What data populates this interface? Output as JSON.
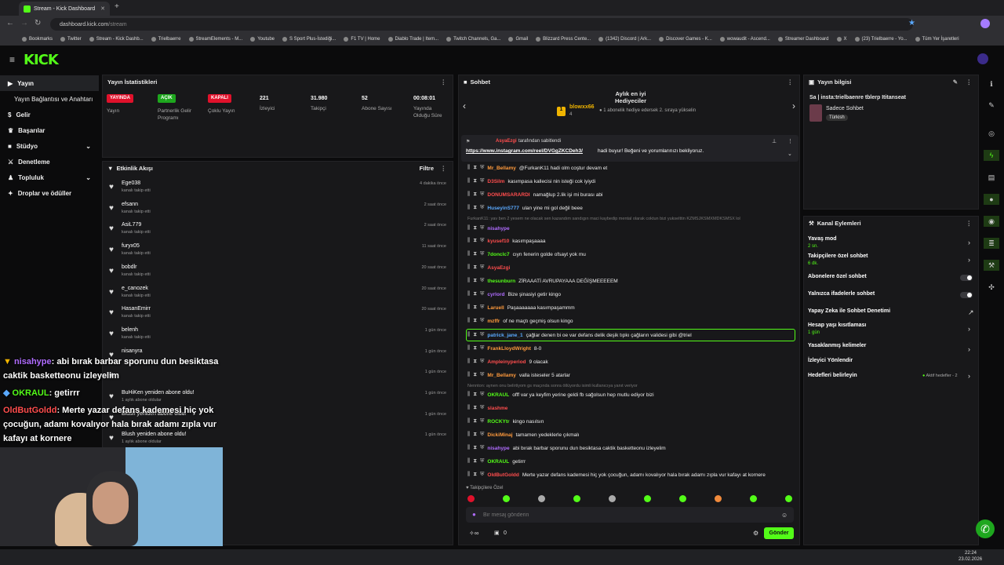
{
  "browser": {
    "tab_title": "Stream - Kick Dashboard",
    "url_host": "dashboard.kick.com",
    "url_path": "/stream",
    "bookmarks": [
      "Bookmarks",
      "Twitter",
      "Stream - Kick Dashb...",
      "Trielbaerre",
      "StreamElements - M...",
      "Youtube",
      "S Sport Plus-İstediği...",
      "F1 TV | Home",
      "Diablo Trade | Item...",
      "Twitch Channels, Ga...",
      "Gmail",
      "Blizzard Press Cente...",
      "(1342) Discord | Ark...",
      "Discover Games - K...",
      "wowaudit - Ascend...",
      "Streamer Dashboard",
      "X",
      "(23) Trielbaerre - Yo...",
      "Tüm Yer İşaretleri"
    ]
  },
  "logo": "KICK",
  "sidebar": {
    "items": [
      {
        "label": "Yayın",
        "icon": "video-icon"
      },
      {
        "label": "Yayın Bağlantısı ve Anahtarı",
        "icon": ""
      },
      {
        "label": "Gelir",
        "icon": "dollar-icon"
      },
      {
        "label": "Başarılar",
        "icon": "trophy-icon"
      },
      {
        "label": "Stüdyo",
        "icon": "camera-icon"
      },
      {
        "label": "Denetleme",
        "icon": "sword-icon"
      },
      {
        "label": "Topluluk",
        "icon": "community-icon"
      },
      {
        "label": "Droplar ve ödüller",
        "icon": "gift-icon"
      }
    ]
  },
  "stats": {
    "title": "Yayın İstatistikleri",
    "items": [
      {
        "badge": "YAYINDA",
        "badge_color": "#e0112b",
        "label": "Yayın"
      },
      {
        "badge": "AÇIK",
        "badge_color": "#1ea71e",
        "label": "Partnerlik Gelir Programı"
      },
      {
        "badge": "KAPALI",
        "badge_color": "#e0112b",
        "label": "Çoklu Yayın"
      },
      {
        "value": "221",
        "label": "İzleyici"
      },
      {
        "value": "31.980",
        "label": "Takipçi"
      },
      {
        "value": "52",
        "label": "Abone Sayısı"
      },
      {
        "value": "00:08:01",
        "label": "Yayında Olduğu Süre"
      }
    ]
  },
  "activity": {
    "title": "Etkinlik Akışı",
    "filter": "Filtre",
    "rows": [
      {
        "name": "Ege038",
        "sub": "kanalı takip etti",
        "time": "4 dakika önce"
      },
      {
        "name": "efsann",
        "sub": "kanalı takip etti",
        "time": "2 saat önce"
      },
      {
        "name": "AsiL779",
        "sub": "kanalı takip etti",
        "time": "2 saat önce"
      },
      {
        "name": "furyx05",
        "sub": "kanalı takip etti",
        "time": "11 saat önce"
      },
      {
        "name": "bobdlr",
        "sub": "kanalı takip etti",
        "time": "20 saat önce"
      },
      {
        "name": "e_canozek",
        "sub": "kanalı takip etti",
        "time": "20 saat önce"
      },
      {
        "name": "HasanEmirr",
        "sub": "kanalı takip etti",
        "time": "20 saat önce"
      },
      {
        "name": "belenh",
        "sub": "kanalı takip etti",
        "time": "1 gün önce"
      },
      {
        "name": "nisanyra",
        "sub": "",
        "time": "1 gün önce"
      },
      {
        "name": "",
        "sub": "",
        "time": "1 gün önce"
      },
      {
        "name": "BuHiKen yeniden abone oldu!",
        "sub": "1 aylık abone oldular",
        "time": "1 gün önce"
      },
      {
        "name": "Blush yeniden abone oldu!",
        "sub": "",
        "time": "1 gün önce"
      },
      {
        "name": "Blush yeniden abone oldu!",
        "sub": "1 aylık abone oldular",
        "time": "1 gün önce"
      }
    ]
  },
  "chat": {
    "title": "Sohbet",
    "gifter_title": "Aylık en iyi Hediyeciler",
    "gifter_name": "blowxx66",
    "gifter_rank": "1",
    "gifter_count": "4",
    "gifter_note": "1 abonelik hediye edersek 2. sıraya yükselin",
    "pinned_by": "AsyaEzgi",
    "pinned_by_suffix": "tarafından sabitlendi",
    "pinned_link": "https://www.instagram.com/reel/DVGgZKCDeh3/",
    "pinned_text": "hadi buyur! Beğeni ve yorumlarınızı bekliyoruz.",
    "messages": [
      {
        "user": "Mr_Bellamy",
        "color": "#ff9a3c",
        "text": "@FurkanK11 hadi olm coştur devam et"
      },
      {
        "user": "D3Silm",
        "color": "#ff4d4d",
        "text": "kasımpasa kallecisi nin isteği cok iyiydi"
      },
      {
        "user": "DONUMSARARDI",
        "color": "#ff4d4d",
        "text": "namağlup 2.lik işi mi burası abi"
      },
      {
        "user": "HuseyinS777",
        "color": "#5aa9ff",
        "text": "ulan yine mi gol değil beee"
      },
      {
        "user": "nisahype",
        "color": "#b06cff",
        "text": ""
      },
      {
        "user": "kyusef10",
        "color": "#ff4d4d",
        "text": "kasımpaşaaaa"
      },
      {
        "user": "7donclc7",
        "color": "#53fc18",
        "text": "cıyn fenerin golde ofsayt yok mu"
      },
      {
        "user": "AsyaEzgi",
        "color": "#ff4d4d",
        "text": ""
      },
      {
        "user": "thesunburn",
        "color": "#53fc18",
        "text": "ZİRAAATİ AVRUPAYAAA DEĞİŞMEEEEEM"
      },
      {
        "user": "cyrlord",
        "color": "#b06cff",
        "text": "Bize şinasiyi getir kingo"
      },
      {
        "user": "Laruell",
        "color": "#ff9a3c",
        "text": "Paşaaaaaaa kasımpaşammm"
      },
      {
        "user": "mzffr",
        "color": "#ff9a3c",
        "text": "of ne maçtı geçmiş olsun kingo"
      },
      {
        "user": "patrick_jane_1",
        "color": "#5aa9ff",
        "text": "çağlar denen bi oe var defans delik deşik tıpkı çağların validesi gibi @triel"
      },
      {
        "user": "FrankLloydWright",
        "color": "#ff9a3c",
        "text": "8-0"
      },
      {
        "user": "Ampleinyperiod",
        "color": "#ff4d4d",
        "text": "9 olacak"
      },
      {
        "user": "Mr_Bellamy",
        "color": "#ff9a3c",
        "text": "valla isteseler 5 atarlar"
      },
      {
        "user": "OKRAUL",
        "color": "#53fc18",
        "text": "offf var ya keyfim yerine geldi fb sağolsun hep mutlu ediyor bizi"
      },
      {
        "user": "slashme",
        "color": "#ff4d4d",
        "text": ""
      },
      {
        "user": "ROCKYtr",
        "color": "#53fc18",
        "text": "kingo nasılsın"
      },
      {
        "user": "DickiMinaj",
        "color": "#ff9a3c",
        "text": "tamamen yedeklerle çıkmalı"
      },
      {
        "user": "nisahype",
        "color": "#b06cff",
        "text": "abi bırak barbar sporunu dun besiktasa caktik basketteonu izleyelim"
      },
      {
        "user": "OKRAUL",
        "color": "#53fc18",
        "text": "getirrr"
      },
      {
        "user": "OldButGoldd",
        "color": "#ff4d4d",
        "text": "Merte yazar defans kademesi hiç yok çocuğun, adamı kovalıyor hala bırak adamı zıpla vur kafayı at kornere"
      }
    ],
    "system_1": "FurkanK11: yav ben 2 yesem ne olacak sen kazandım sandıgın maci kaybedip mental olarak coktun bizi yukselttin KZMSJKSMXMDKSMSX lol",
    "system_2": "Nennton: aynen onu belirtiyom gs maçında sonra ötlüyordu isimli kullanıcıya yanıt veriyor",
    "followers_only": "Takipçilere Özel",
    "input_placeholder": "Bir mesaj gönderin",
    "send_label": "Gönder",
    "points": "0"
  },
  "stream_info": {
    "title": "Yayın bilgisi",
    "stream_title": "Sa | insta:trielbaenre tblerp Ititanseat",
    "category": "Sadece Sohbet",
    "tag": "Türkish"
  },
  "channel_actions": {
    "title": "Kanal Eylemleri",
    "items": [
      {
        "label": "Yavaş mod",
        "sub": "2 sn.",
        "control": "chevron"
      },
      {
        "label": "Takipçilere özel sohbet",
        "sub": "6 dk.",
        "control": "chevron"
      },
      {
        "label": "Abonelere özel sohbet",
        "sub": "",
        "control": "toggle"
      },
      {
        "label": "Yalnızca ifadelerle sohbet",
        "sub": "",
        "control": "toggle"
      },
      {
        "label": "Yapay Zeka ile Sohbet Denetimi",
        "sub": "",
        "control": "external"
      },
      {
        "label": "Hesap yaşı kısıtlaması",
        "sub": "1 gün",
        "control": "chevron"
      },
      {
        "label": "Yasaklanmış kelimeler",
        "sub": "",
        "control": "chevron"
      },
      {
        "label": "İzleyici Yönlendir",
        "sub": "",
        "control": "none"
      },
      {
        "label": "Hedefleri belirleyin",
        "sub": "",
        "control": "goals"
      }
    ],
    "goals_note": "Aktif hedefler - 2"
  },
  "overlay": {
    "lines": [
      {
        "user": "nisahype",
        "user_color": "#b06cff",
        "text": ": abi bırak barbar sporunu dun besiktasa caktik basketteonu izleyelim"
      },
      {
        "user": "OKRAUL",
        "user_color": "#53fc18",
        "text": ": getirrr"
      },
      {
        "user": "OldButGoldd",
        "user_color": "#ff4d4d",
        "text": ": Merte yazar defans kademesi hiç yok çocuğun, adamı kovalıyor hala bırak adamı zıpla vur kafayı at kornere"
      }
    ]
  },
  "taskbar": {
    "time": "22:24",
    "date": "23.02.2026"
  },
  "colors": {
    "accent": "#53fc18",
    "live": "#e0112b",
    "panel": "#18181a"
  }
}
